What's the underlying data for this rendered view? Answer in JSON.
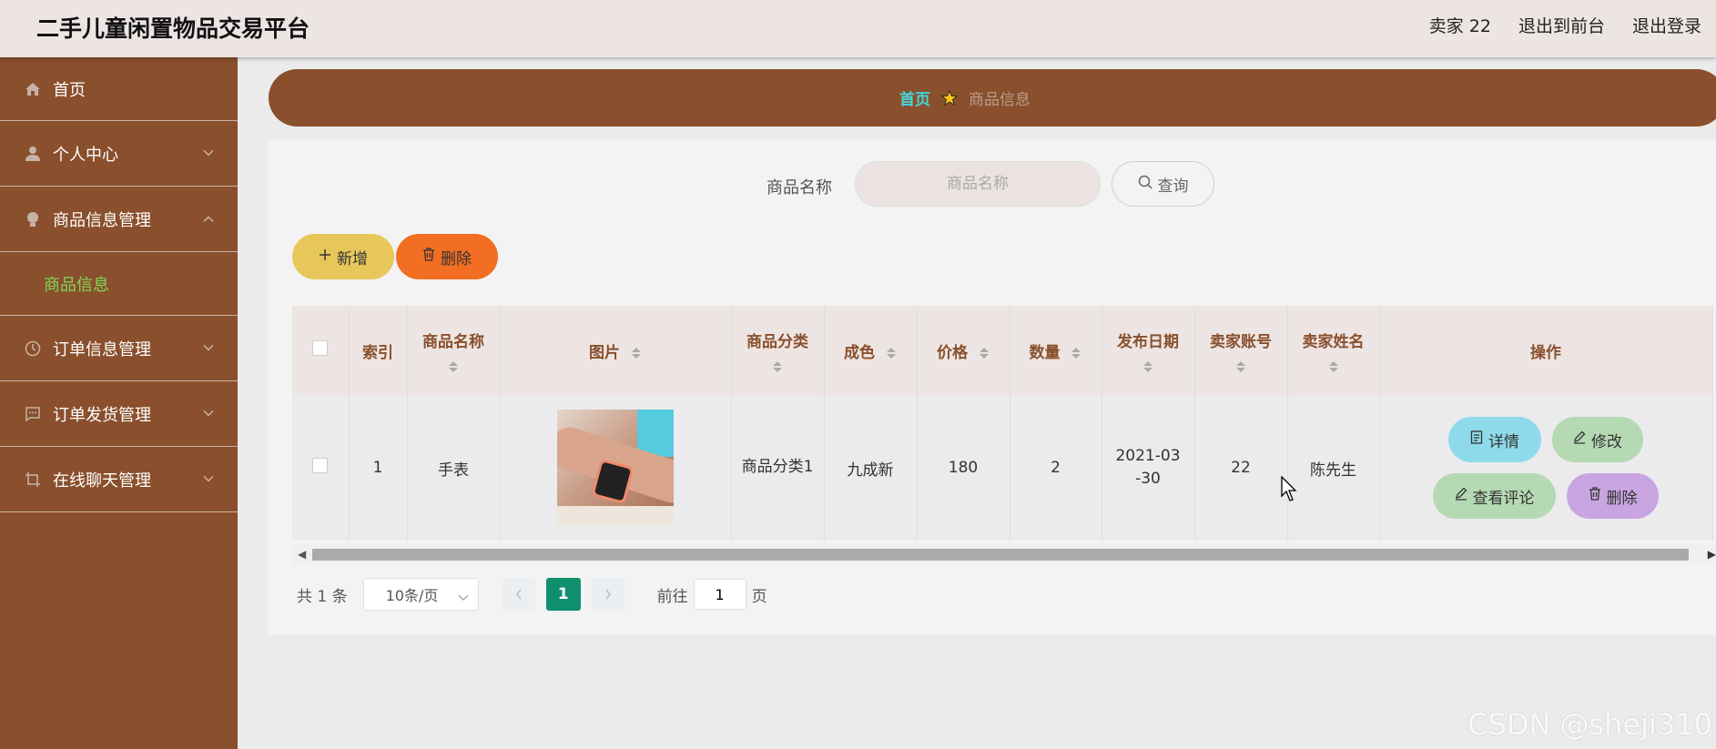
{
  "app": {
    "title": "二手儿童闲置物品交易平台"
  },
  "header": {
    "user": "卖家 22",
    "to_front": "退出到前台",
    "logout": "退出登录"
  },
  "sidebar": {
    "items": [
      {
        "label": "首页",
        "icon": "home-icon"
      },
      {
        "label": "个人中心",
        "icon": "user-icon"
      },
      {
        "label": "商品信息管理",
        "icon": "bulb-icon"
      },
      {
        "label": "商品信息",
        "sub": true
      },
      {
        "label": "订单信息管理",
        "icon": "clock-icon"
      },
      {
        "label": "订单发货管理",
        "icon": "chat-icon"
      },
      {
        "label": "在线聊天管理",
        "icon": "crop-icon"
      }
    ]
  },
  "breadcrumb": {
    "home": "首页",
    "current": "商品信息"
  },
  "search": {
    "label": "商品名称",
    "placeholder": "商品名称",
    "button": "查询"
  },
  "actions": {
    "add": "新增",
    "delete": "删除"
  },
  "table": {
    "columns": [
      "索引",
      "商品名称",
      "图片",
      "商品分类",
      "成色",
      "价格",
      "数量",
      "发布日期",
      "卖家账号",
      "卖家姓名",
      "操作"
    ],
    "rows": [
      {
        "index": "1",
        "name": "手表",
        "image": "watch-photo",
        "category": "商品分类1",
        "condition": "九成新",
        "price": "180",
        "quantity": "2",
        "date": "2021-03-30",
        "account": "22",
        "seller": "陈先生"
      }
    ],
    "ops": {
      "detail": "详情",
      "edit": "修改",
      "review": "查看评论",
      "delete": "删除"
    }
  },
  "pagination": {
    "total": "共 1 条",
    "page_size": "10条/页",
    "current": "1",
    "goto_label": "前往",
    "goto_value": "1",
    "page_suffix": "页"
  },
  "watermark": "CSDN @sheji310",
  "colors": {
    "sidebar": "#8a4f2c",
    "accent_green": "#0e8f6e",
    "breadcrumb_home": "#44d6dc",
    "header_text": "#8a4f2c"
  }
}
